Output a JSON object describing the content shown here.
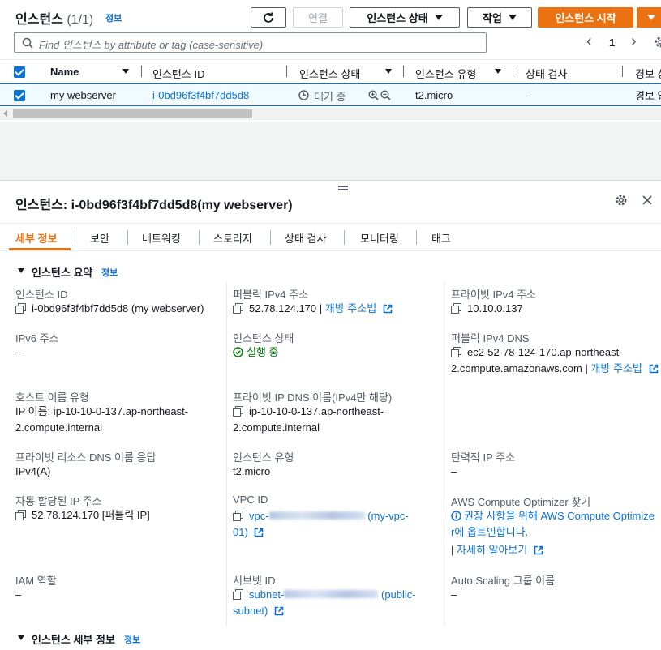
{
  "toolbar": {
    "title": "인스턴스",
    "count": "(1/1)",
    "info_link": "정보",
    "connect_label": "연결",
    "instance_state_label": "인스턴스 상태",
    "actions_label": "작업",
    "launch_label": "인스턴스 시작"
  },
  "search": {
    "placeholder": "Find 인스턴스 by attribute or tag (case-sensitive)"
  },
  "pagination": {
    "page": "1"
  },
  "table": {
    "columns": [
      "Name",
      "인스턴스 ID",
      "인스턴스 상태",
      "인스턴스 유형",
      "상태 검사",
      "경보 상"
    ],
    "row": {
      "name": "my webserver",
      "instance_id": "i-0bd96f3f4bf7dd5d8",
      "state": "대기 중",
      "type": "t2.micro",
      "status_check": "–",
      "alarm": "경보 없"
    }
  },
  "detail": {
    "title": "인스턴스: i-0bd96f3f4bf7dd5d8(my webserver)",
    "tabs": [
      "세부 정보",
      "보안",
      "네트워킹",
      "스토리지",
      "상태 검사",
      "모니터링",
      "태그"
    ],
    "active_tab": "세부 정보",
    "summary_title": "인스턴스 요약",
    "summary_info": "정보",
    "fields": {
      "instance_id_label": "인스턴스 ID",
      "instance_id_value": "i-0bd96f3f4bf7dd5d8 (my webserver)",
      "public_ip_label": "퍼블릭 IPv4 주소",
      "public_ip_value": "52.78.124.170 |",
      "public_ip_link": "개방 주소법",
      "private_ip_label": "프라이빗 IPv4 주소",
      "private_ip_value": "10.10.0.137",
      "ipv6_label": "IPv6 주소",
      "ipv6_value": "–",
      "state_label": "인스턴스 상태",
      "state_value": "실행 중",
      "public_dns_label": "퍼블릭 IPv4 DNS",
      "public_dns_value_1": "ec2-52-78-124-170.ap-northeast-",
      "public_dns_value_2": "2.compute.amazonaws.com |",
      "public_dns_link": "개방 주소법",
      "hostname_type_label": "호스트 이름 유형",
      "hostname_type_value_1": "IP 이름: ip-10-10-0-137.ap-northeast-",
      "hostname_type_value_2": "2.compute.internal",
      "private_dns_label": "프라이빗 IP DNS 이름(IPv4만 해당)",
      "private_dns_value_1": "ip-10-10-0-137.ap-northeast-",
      "private_dns_value_2": "2.compute.internal",
      "resource_dns_label": "프라이빗 리소스 DNS 이름 응답",
      "resource_dns_value": "IPv4(A)",
      "instance_type_label": "인스턴스 유형",
      "instance_type_value": "t2.micro",
      "elastic_ip_label": "탄력적 IP 주소",
      "elastic_ip_value": "–",
      "auto_ip_label": "자동 할당된 IP 주소",
      "auto_ip_value": "52.78.124.170 [퍼블릭 IP]",
      "vpc_label": "VPC ID",
      "vpc_prefix": "vpc-",
      "vpc_suffix": "(my-vpc-",
      "vpc_suffix_2": "01)",
      "optimizer_label": "AWS Compute Optimizer 찾기",
      "optimizer_text_1": "권장 사항을 위해 AWS Compute Optimize",
      "optimizer_text_2": "r에 옵트인합니다.",
      "optimizer_learn": "자세히 알아보기",
      "iam_label": "IAM 역할",
      "iam_value": "–",
      "subnet_label": "서브넷 ID",
      "subnet_prefix": "subnet-",
      "subnet_suffix": "(public-",
      "subnet_suffix_2": "subnet)",
      "asg_label": "Auto Scaling 그룹 이름",
      "asg_value": "–"
    },
    "details_section_title": "인스턴스 세부 정보",
    "details_section_info": "정보"
  },
  "colors": {
    "accent": "#0972d3",
    "primary_button": "#ec7211",
    "success": "#037f0c"
  }
}
